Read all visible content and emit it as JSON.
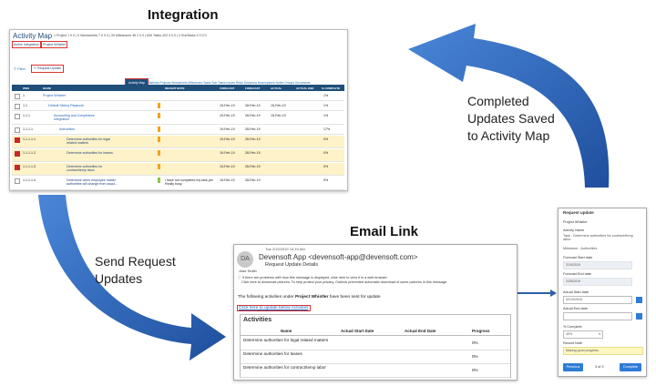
{
  "labels": {
    "integration": "Integration",
    "email_link": "Email Link",
    "completed": [
      "Completed",
      "Updates Saved",
      "to Activity Map"
    ],
    "send_request": [
      "Send Request",
      "Updates"
    ]
  },
  "activity_map": {
    "title": "Activity Map",
    "stats": "1 Project 1 0 0 | 0 Worksheets 7 0 0 0 | 30 Milestones 46 2 0 0 | 626 Tasks 422 4 0 0 | 2 SubTasks 2 0 0 0",
    "chip_active": "Active Integration",
    "chip_project": "Project Whistler",
    "filter": "Filter",
    "request_update": "Request Update",
    "nav_selected": "Activity Map",
    "nav": "Materials   Projects   Worksheets   Milestones   Tasks   Sub Tasks   Issues   Risks   Decisions   Assumptions   Notes   Groups   Documents",
    "headers": [
      "WBS",
      "NAME",
      "RECENT NOTE",
      "FORECAST START DATE",
      "FORECAST END DATE",
      "ACTUAL START DATE",
      "ACTUAL END DATE",
      "% COMPLETE"
    ],
    "rows": [
      {
        "wbs": "1",
        "name": "Project Whistler",
        "note": "",
        "fs": "",
        "fe": "",
        "as": "",
        "ae": "",
        "pct": "1%"
      },
      {
        "wbs": "1.1",
        "name": "Default Skinny Playbook",
        "note": "",
        "fs": "19-Feb-19",
        "fe": "28-Feb-19",
        "as": "15-Feb-19",
        "ae": "",
        "pct": "1%"
      },
      {
        "wbs": "1.1.1",
        "name": "Accounting and Compliance Integration",
        "note": "",
        "fs": "19-Feb-19",
        "fe": "28-Feb-19",
        "as": "15-Feb-19",
        "ae": "",
        "pct": "1%"
      },
      {
        "wbs": "1.1.1.1",
        "name": "Authorities",
        "note": "",
        "fs": "19-Feb-19",
        "fe": "28-Feb-19",
        "as": "",
        "ae": "",
        "pct": "17%"
      },
      {
        "wbs": "1.1.1.1.1",
        "name": "Determine authorities for legal related matters",
        "note": "",
        "fs": "19-Feb-19",
        "fe": "28-Feb-19",
        "as": "",
        "ae": "",
        "pct": "0%"
      },
      {
        "wbs": "1.1.1.1.2",
        "name": "Determine authorities for leases",
        "note": "",
        "fs": "19-Feb-19",
        "fe": "28-Feb-19",
        "as": "",
        "ae": "",
        "pct": "0%"
      },
      {
        "wbs": "1.1.1.1.3",
        "name": "Determine authorities for contract/temp labor",
        "note": "",
        "fs": "19-Feb-19",
        "fe": "28-Feb-19",
        "as": "",
        "ae": "",
        "pct": "0%"
      },
      {
        "wbs": "1.1.1.1.4",
        "name": "Determine when employee matter authorities will change from acqui...",
        "note": "I have not completed my task yet. Really busy.",
        "fs": "19-Feb-19",
        "fe": "28-Feb-19",
        "as": "",
        "ae": "",
        "pct": "0%"
      },
      {
        "wbs": "1.1.1.1.5",
        "name": "Understand existing authority levels at acquisition and",
        "note": "",
        "fs": "",
        "fe": "",
        "as": "",
        "ae": "",
        "pct": "40%"
      }
    ]
  },
  "email": {
    "date": "Tue 2/19/2019 10:19 AM",
    "avatar": "DA",
    "from": "Devensoft App <devensoft-app@devensoft.com>",
    "subject": "Request Update Details",
    "to": "Jose Smith",
    "info1": "If there are problems with how this message is displayed, click here to view it in a web browser.",
    "info2": "Click here to download pictures. To help protect your privacy, Outlook prevented automatic download of some pictures in this message.",
    "body_pre": "The following activities under ",
    "body_project": "Project Whistler",
    "body_post": " have been sent for update",
    "link": "Click here to update below Activities",
    "activities_title": "Activities",
    "columns": [
      "Name",
      "Actual Start Date",
      "Actual End Date",
      "Progress"
    ],
    "rows": [
      {
        "name": "Determine authorities for legal related matters",
        "progress": "0%"
      },
      {
        "name": "Determine authorities for leases",
        "progress": "0%"
      },
      {
        "name": "Determine authorities for contract/temp labor",
        "progress": "0%"
      }
    ]
  },
  "request_update": {
    "title": "Request update",
    "project": "Project Whistler",
    "activity_name_label": "Activity Name",
    "activity_name": "Task - Determine authorities for contract/temp labor",
    "milestone": "Milestone - Authorities",
    "forecast_start_label": "Forecast Start date",
    "forecast_start": "2/19/2019",
    "forecast_end_label": "Forecast End date",
    "forecast_end": "2/28/2019",
    "actual_start_label": "Actual Start date",
    "actual_start": "02/19/2019",
    "actual_end_label": "Actual End date",
    "actual_end": "",
    "pct_label": "% Complete",
    "pct": "40%",
    "note_label": "Recent Note",
    "note": "Making good progress.",
    "previous": "Previous",
    "page": "3 of 3",
    "complete": "Complete"
  }
}
